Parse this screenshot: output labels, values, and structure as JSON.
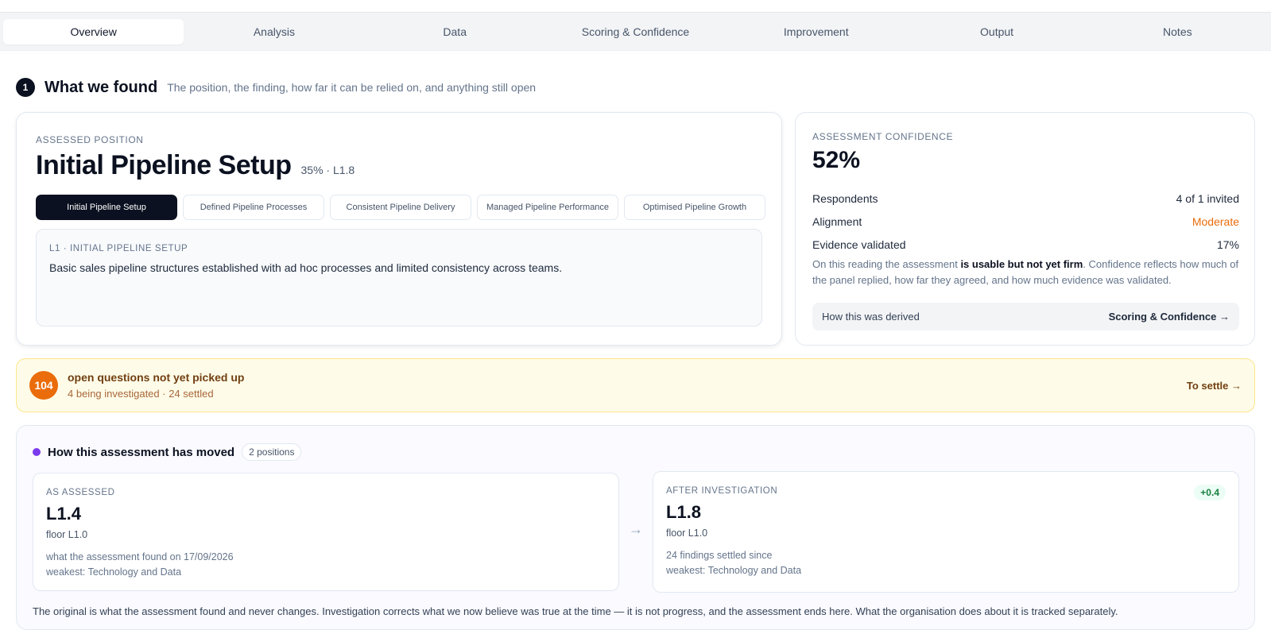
{
  "tabs": [
    "Overview",
    "Analysis",
    "Data",
    "Scoring & Confidence",
    "Improvement",
    "Output",
    "Notes"
  ],
  "section": {
    "number": "1",
    "title": "What we found",
    "subtitle": "The position, the finding, how far it can be relied on, and anything still open"
  },
  "position": {
    "eyebrow": "ASSESSED POSITION",
    "title": "Initial Pipeline Setup",
    "meta": "35% · L1.8",
    "levels": [
      "Initial Pipeline Setup",
      "Defined Pipeline Processes",
      "Consistent Pipeline Delivery",
      "Managed Pipeline Performance",
      "Optimised Pipeline Growth"
    ],
    "level_box": {
      "eyebrow": "L1 · INITIAL PIPELINE SETUP",
      "text": "Basic sales pipeline structures established with ad hoc processes and limited consistency across teams."
    }
  },
  "confidence": {
    "eyebrow": "ASSESSMENT CONFIDENCE",
    "value": "52%",
    "rows": [
      {
        "label": "Respondents",
        "value": "4 of 1 invited"
      },
      {
        "label": "Alignment",
        "value": "Moderate"
      },
      {
        "label": "Evidence validated",
        "value": "17%"
      }
    ],
    "note_pre": "On this reading the assessment ",
    "note_bold": "is usable but not yet firm",
    "note_post": ". Confidence reflects how much of the panel replied, how far they agreed, and how much evidence was validated.",
    "derived_label": "How this was derived",
    "derived_link": "Scoring & Confidence →",
    "colors": {
      "moderate": "#ea6c0a"
    }
  },
  "banner": {
    "count": "104",
    "title": "open questions not yet picked up",
    "sub": "4 being investigated · 24 settled",
    "action": "To settle →"
  },
  "movement": {
    "title": "How this assessment has moved",
    "pill": "2 positions",
    "assessed": {
      "eyebrow": "AS ASSESSED",
      "level": "L1.4",
      "floor": "floor L1.0",
      "line1": "what the assessment found on 17/09/2026",
      "line2": "weakest: Technology and Data"
    },
    "after": {
      "eyebrow": "AFTER INVESTIGATION",
      "level": "L1.8",
      "floor": "floor L1.0",
      "line1": "24 findings settled since",
      "line2": "weakest: Technology and Data",
      "delta": "+0.4"
    },
    "arrow": "→",
    "footnote": "The original is what the assessment found and never changes. Investigation corrects what we now believe was true at the time — it is not progress, and the assessment ends here. What the organisation does about it is tracked separately."
  }
}
